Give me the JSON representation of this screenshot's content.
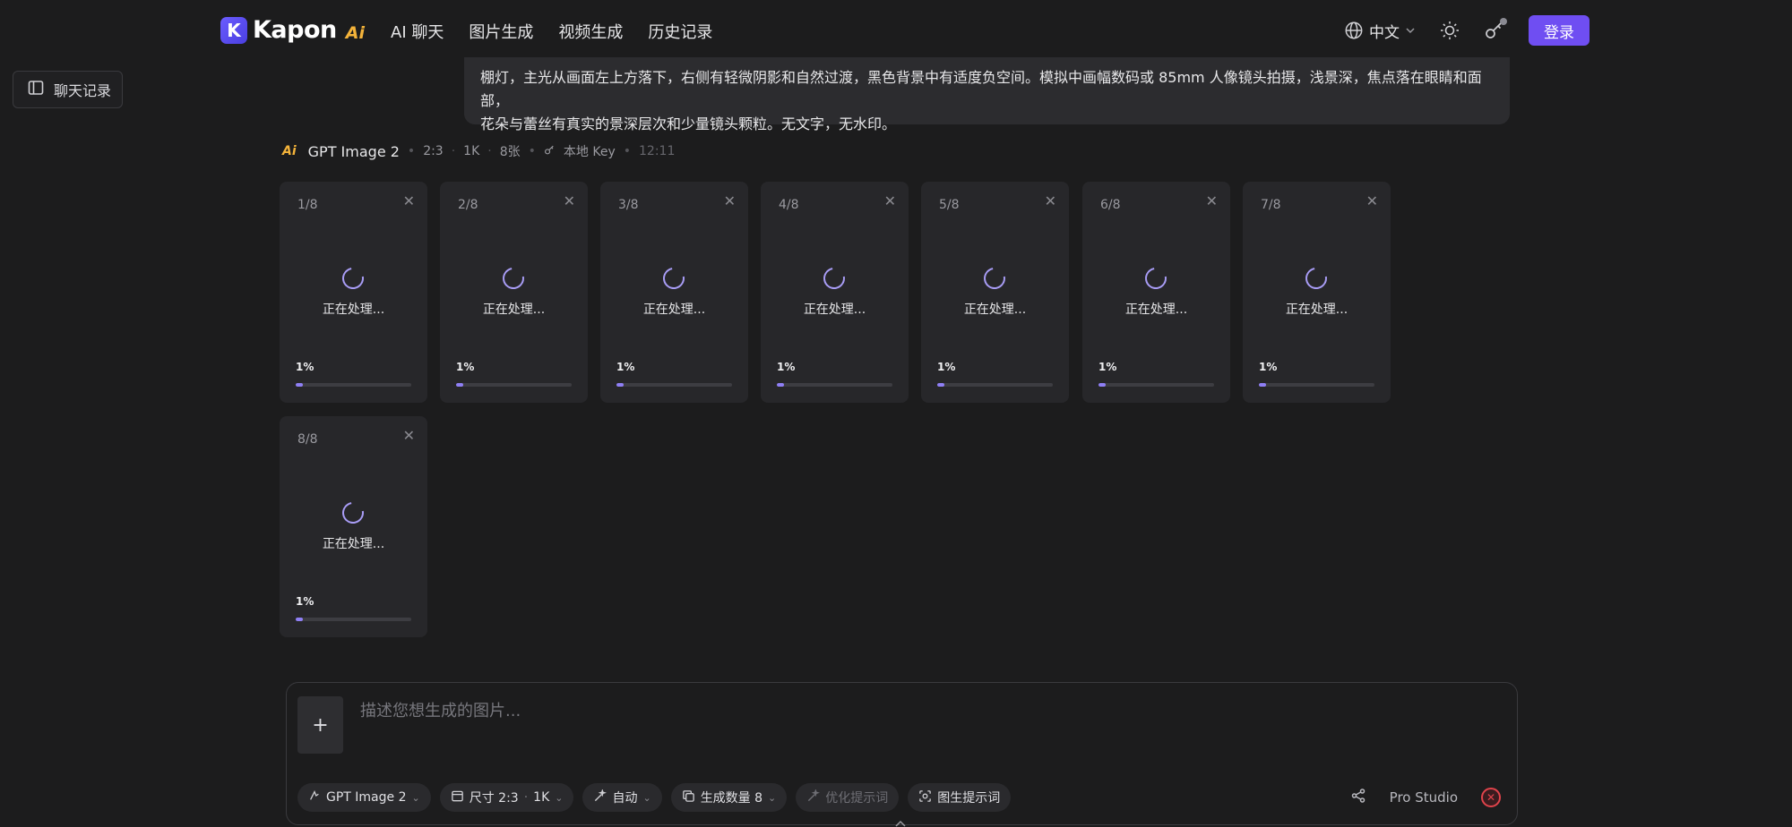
{
  "header": {
    "brand": "Kapon",
    "brand_ai": "Ai",
    "brand_mark": "K",
    "nav": [
      "AI 聊天",
      "图片生成",
      "视频生成",
      "历史记录"
    ],
    "language": "中文",
    "login": "登录"
  },
  "sidebar": {
    "chat_history": "聊天记录"
  },
  "prompt": {
    "line1": "棚灯，主光从画面左上方落下，右侧有轻微阴影和自然过渡，黑色背景中有适度负空间。模拟中画幅数码或 85mm 人像镜头拍摄，浅景深，焦点落在眼睛和面部，",
    "line2": "花朵与蕾丝有真实的景深层次和少量镜头颗粒。无文字，无水印。"
  },
  "meta": {
    "ai_label": "Ai",
    "model": "GPT Image 2",
    "ratio": "2:3",
    "resolution": "1K",
    "count": "8张",
    "key": "本地 Key",
    "time": "12:11"
  },
  "cards": [
    {
      "index": "1/8",
      "status": "正在处理...",
      "progress": "1%",
      "progress_value": 0.06
    },
    {
      "index": "2/8",
      "status": "正在处理...",
      "progress": "1%",
      "progress_value": 0.06
    },
    {
      "index": "3/8",
      "status": "正在处理...",
      "progress": "1%",
      "progress_value": 0.06
    },
    {
      "index": "4/8",
      "status": "正在处理...",
      "progress": "1%",
      "progress_value": 0.06
    },
    {
      "index": "5/8",
      "status": "正在处理...",
      "progress": "1%",
      "progress_value": 0.06
    },
    {
      "index": "6/8",
      "status": "正在处理...",
      "progress": "1%",
      "progress_value": 0.06
    },
    {
      "index": "7/8",
      "status": "正在处理...",
      "progress": "1%",
      "progress_value": 0.06
    },
    {
      "index": "8/8",
      "status": "正在处理...",
      "progress": "1%",
      "progress_value": 0.06
    }
  ],
  "composer": {
    "placeholder": "描述您想生成的图片...",
    "add": "+",
    "model": "GPT Image 2",
    "size_label": "尺寸 2:3",
    "size_res": "1K",
    "auto": "自动",
    "count_label": "生成数量 8",
    "optimize": "优化提示词",
    "image_prompt": "图生提示词",
    "pro_studio": "Pro Studio"
  },
  "colors": {
    "accent": "#6f4ef2",
    "progress": "#8f7ff5",
    "brand_ai": "#f4b33a",
    "stop": "#e0434b"
  }
}
